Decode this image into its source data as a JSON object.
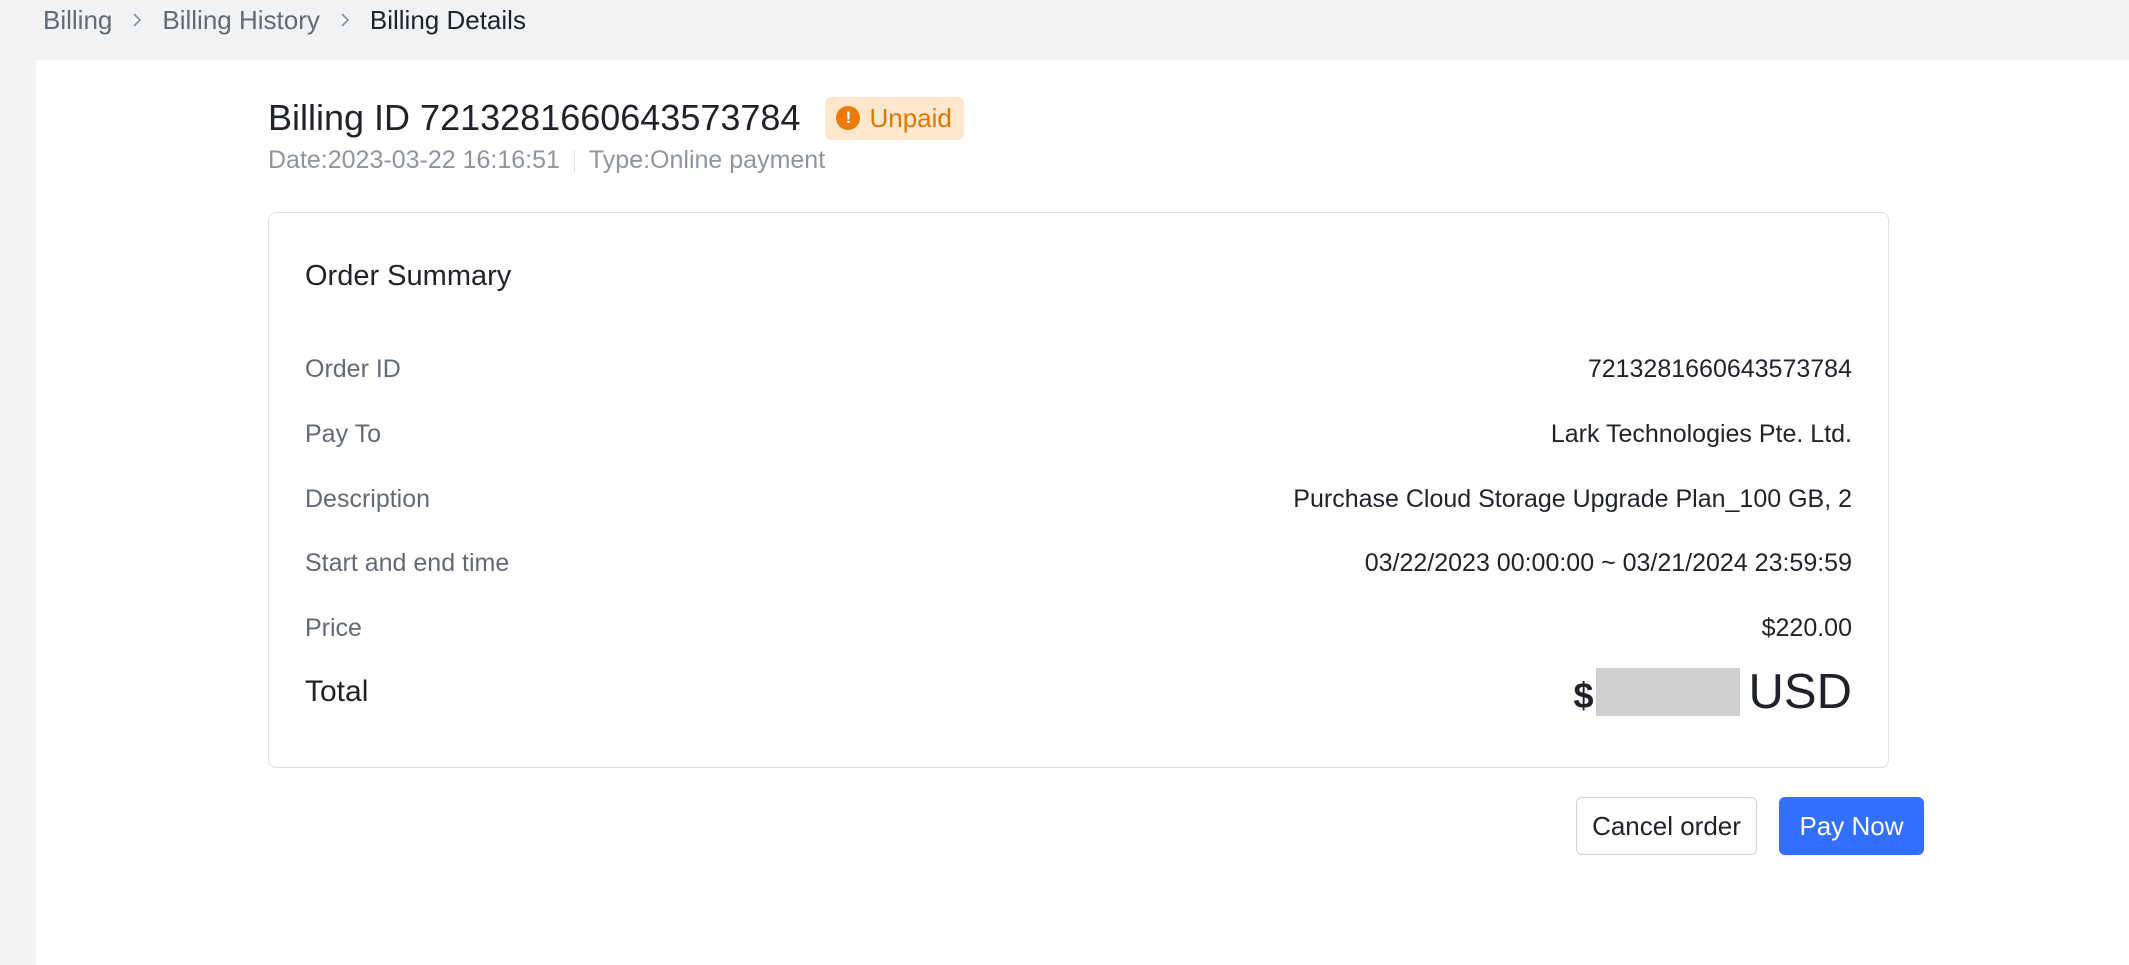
{
  "breadcrumb": {
    "items": [
      "Billing",
      "Billing History",
      "Billing Details"
    ]
  },
  "header": {
    "title": "Billing ID 7213281660643573784",
    "status": "Unpaid",
    "status_icon": "exclamation-circle-icon",
    "date": "Date:2023-03-22 16:16:51",
    "type": "Type:Online payment"
  },
  "summary": {
    "title": "Order Summary",
    "rows": [
      {
        "label": "Order ID",
        "value": "7213281660643573784"
      },
      {
        "label": "Pay To",
        "value": "Lark Technologies Pte. Ltd."
      },
      {
        "label": "Description",
        "value": "Purchase Cloud Storage Upgrade Plan_100 GB, 2"
      },
      {
        "label": "Start and end time",
        "value": "03/22/2023 00:00:00 ~ 03/21/2024 23:59:59"
      },
      {
        "label": "Price",
        "value": "$220.00"
      }
    ],
    "total_label": "Total",
    "total_currency_symbol": "$",
    "total_currency": "USD"
  },
  "actions": {
    "cancel_label": "Cancel order",
    "pay_label": "Pay Now"
  },
  "colors": {
    "accent": "#3370ff",
    "status_bg": "#fee7cd",
    "status_text": "#de7802"
  }
}
